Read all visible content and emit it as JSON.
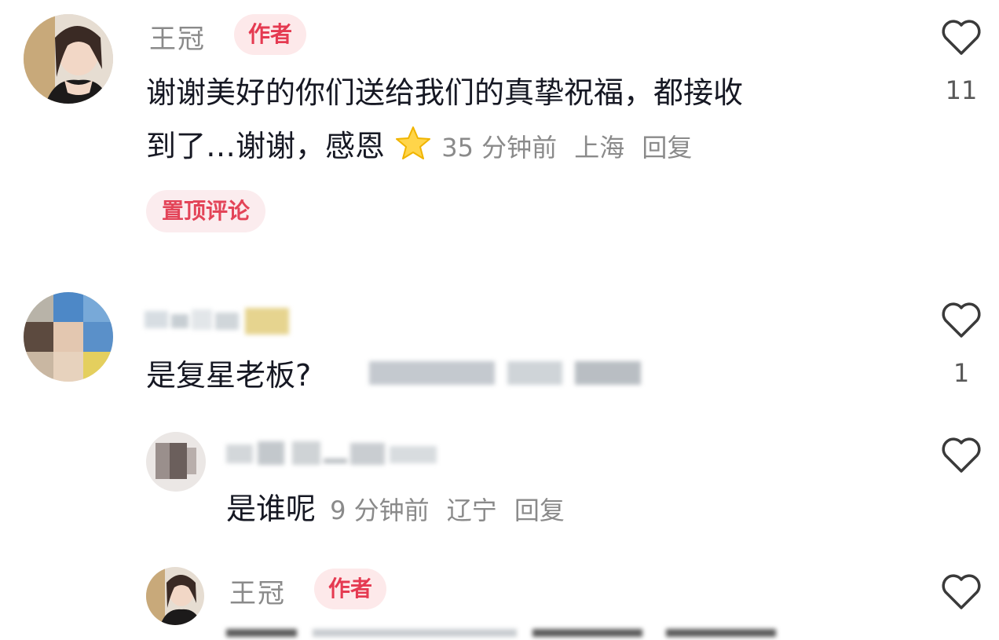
{
  "comments": [
    {
      "author": "王冠",
      "author_badge": "作者",
      "text_line1": "谢谢美好的你们送给我们的真挚祝福，都接收",
      "text_line2": "到了…谢谢，感恩",
      "emoji": "star-emoji",
      "time": "35 分钟前",
      "location": "上海",
      "reply_label": "回复",
      "pinned_label": "置顶评论",
      "likes": "11"
    },
    {
      "text": "是复星老板?",
      "likes": "1"
    }
  ],
  "replies": [
    {
      "text": "是谁呢",
      "time": "9 分钟前",
      "location": "辽宁",
      "reply_label": "回复"
    },
    {
      "author": "王冠",
      "author_badge": "作者"
    }
  ],
  "icons": {
    "like": "heart-outline-icon"
  },
  "colors": {
    "accent": "#e53a51",
    "badge_bg": "#fde9ea",
    "muted": "#8a8a8a"
  }
}
